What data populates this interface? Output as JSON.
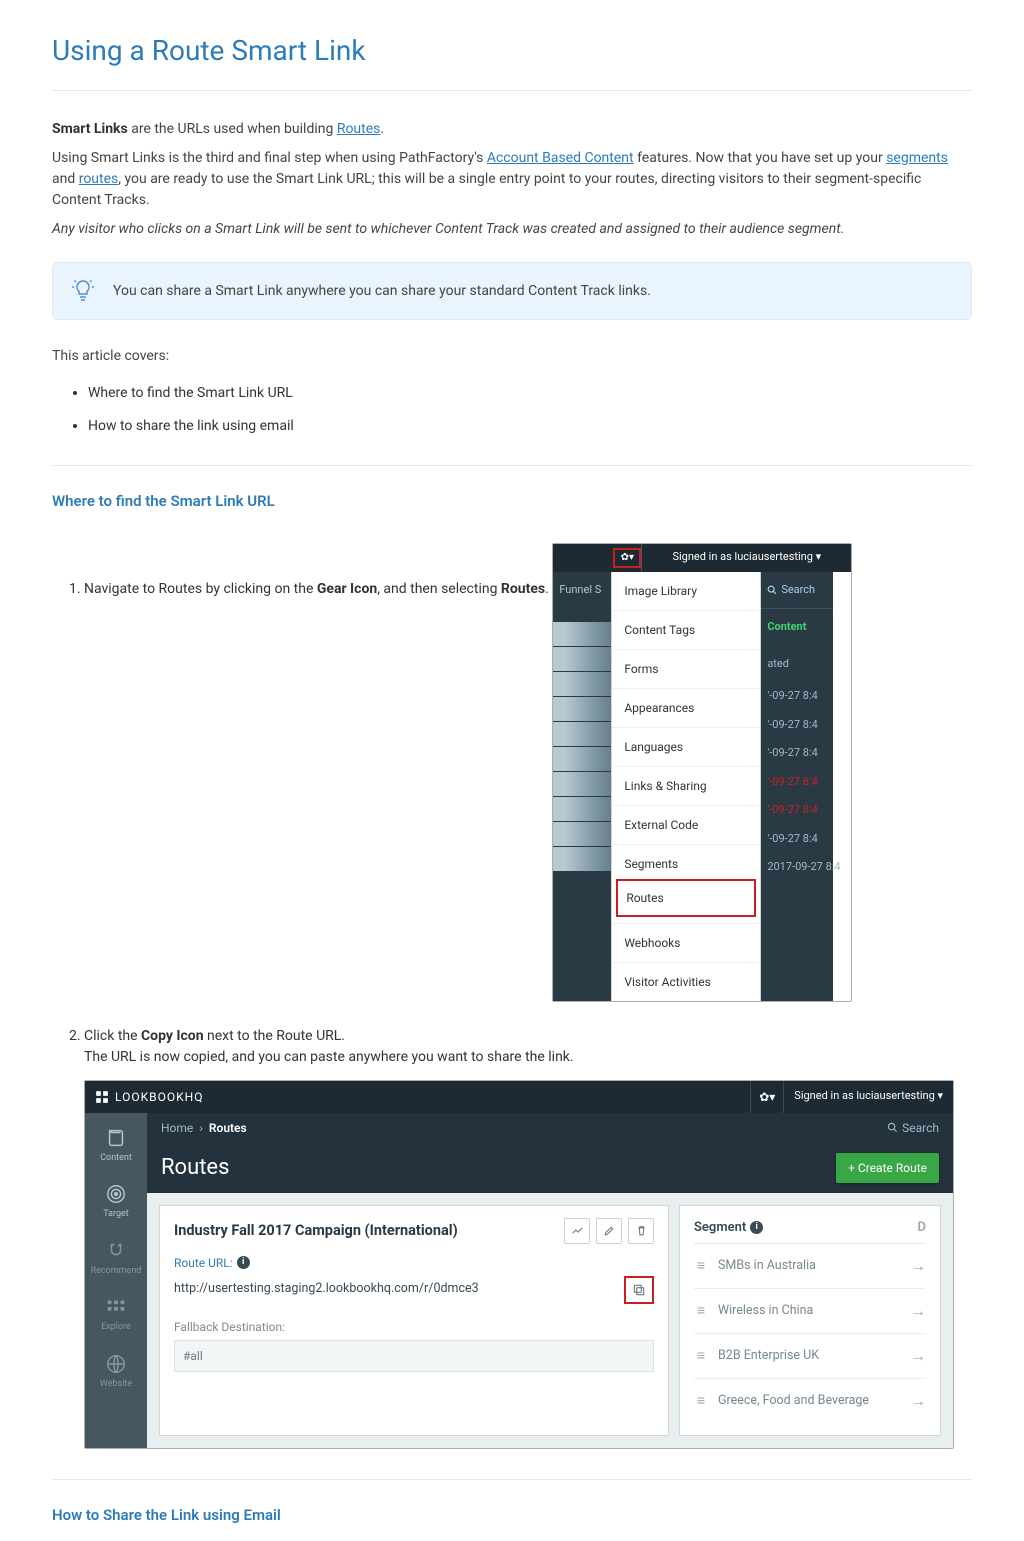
{
  "page": {
    "title": "Using a Route Smart Link"
  },
  "intro": {
    "line1_prefix": "Smart Links",
    "line1_mid": " are the URLs used when building ",
    "line1_link": "Routes",
    "line1_suffix": ".",
    "line2_a": "Using Smart Links is the third and final step when using PathFactory's ",
    "line2_link1": "Account Based Content",
    "line2_b": " features. Now that you have set up your ",
    "line2_link2": "segments",
    "line2_c": " and ",
    "line2_link3": "routes",
    "line2_d": ", you are ready to use the Smart Link URL; this will be a single entry point to your routes, directing visitors to their segment-specific Content Tracks.",
    "italic": "Any visitor who clicks on a Smart Link will be sent to whichever Content Track was created and assigned to their audience segment."
  },
  "tip": {
    "text": "You can share a Smart Link anywhere you can share your standard Content Track links."
  },
  "covers": {
    "lead": "This article covers:",
    "items": [
      "Where to find the Smart Link URL",
      "How to share the link using email"
    ]
  },
  "section1": {
    "title": "Where to find the Smart Link URL",
    "step1_a": "Navigate to Routes by clicking on the ",
    "step1_b": "Gear Icon",
    "step1_c": ", and then selecting ",
    "step1_d": "Routes",
    "step1_e": "."
  },
  "shot1": {
    "signed": "Signed in as luciausertesting ▾",
    "funnel": "Funnel S",
    "search": "Search",
    "content": "Content",
    "ated": "ated",
    "menu": [
      "Image Library",
      "Content Tags",
      "Forms",
      "Appearances",
      "Languages",
      "Links & Sharing",
      "External Code",
      "Segments",
      "Routes",
      "Webhooks",
      "Visitor Activities"
    ],
    "date": "'-09-27 8:4",
    "date_long": "2017-09-27 8:4"
  },
  "step2": {
    "a": "Click the ",
    "b": "Copy Icon",
    "c": " next to the Route URL.",
    "sub": "The URL is now copied, and you can paste anywhere you want to share the link."
  },
  "shot2": {
    "logo": "LOOKBOOKHQ",
    "signed": "Signed in as luciausertesting ▾",
    "rail": [
      "Content",
      "Target",
      "Recommend",
      "Explore",
      "Website"
    ],
    "crumb_home": "Home",
    "crumb_routes": "Routes",
    "search": "Search",
    "routes_title": "Routes",
    "create": "+ Create Route",
    "campaign": "Industry Fall 2017 Campaign (International)",
    "routeurl_label": "Route URL:",
    "url": "http://usertesting.staging2.lookbookhq.com/r/0dmce3",
    "fallback_label": "Fallback Destination:",
    "fallback_value": "#all",
    "segment_head": "Segment",
    "segment_d": "D",
    "segments": [
      "SMBs in Australia",
      "Wireless in China",
      "B2B Enterprise UK",
      "Greece, Food and Beverage"
    ]
  },
  "section2": {
    "title": "How to Share the Link using Email"
  }
}
